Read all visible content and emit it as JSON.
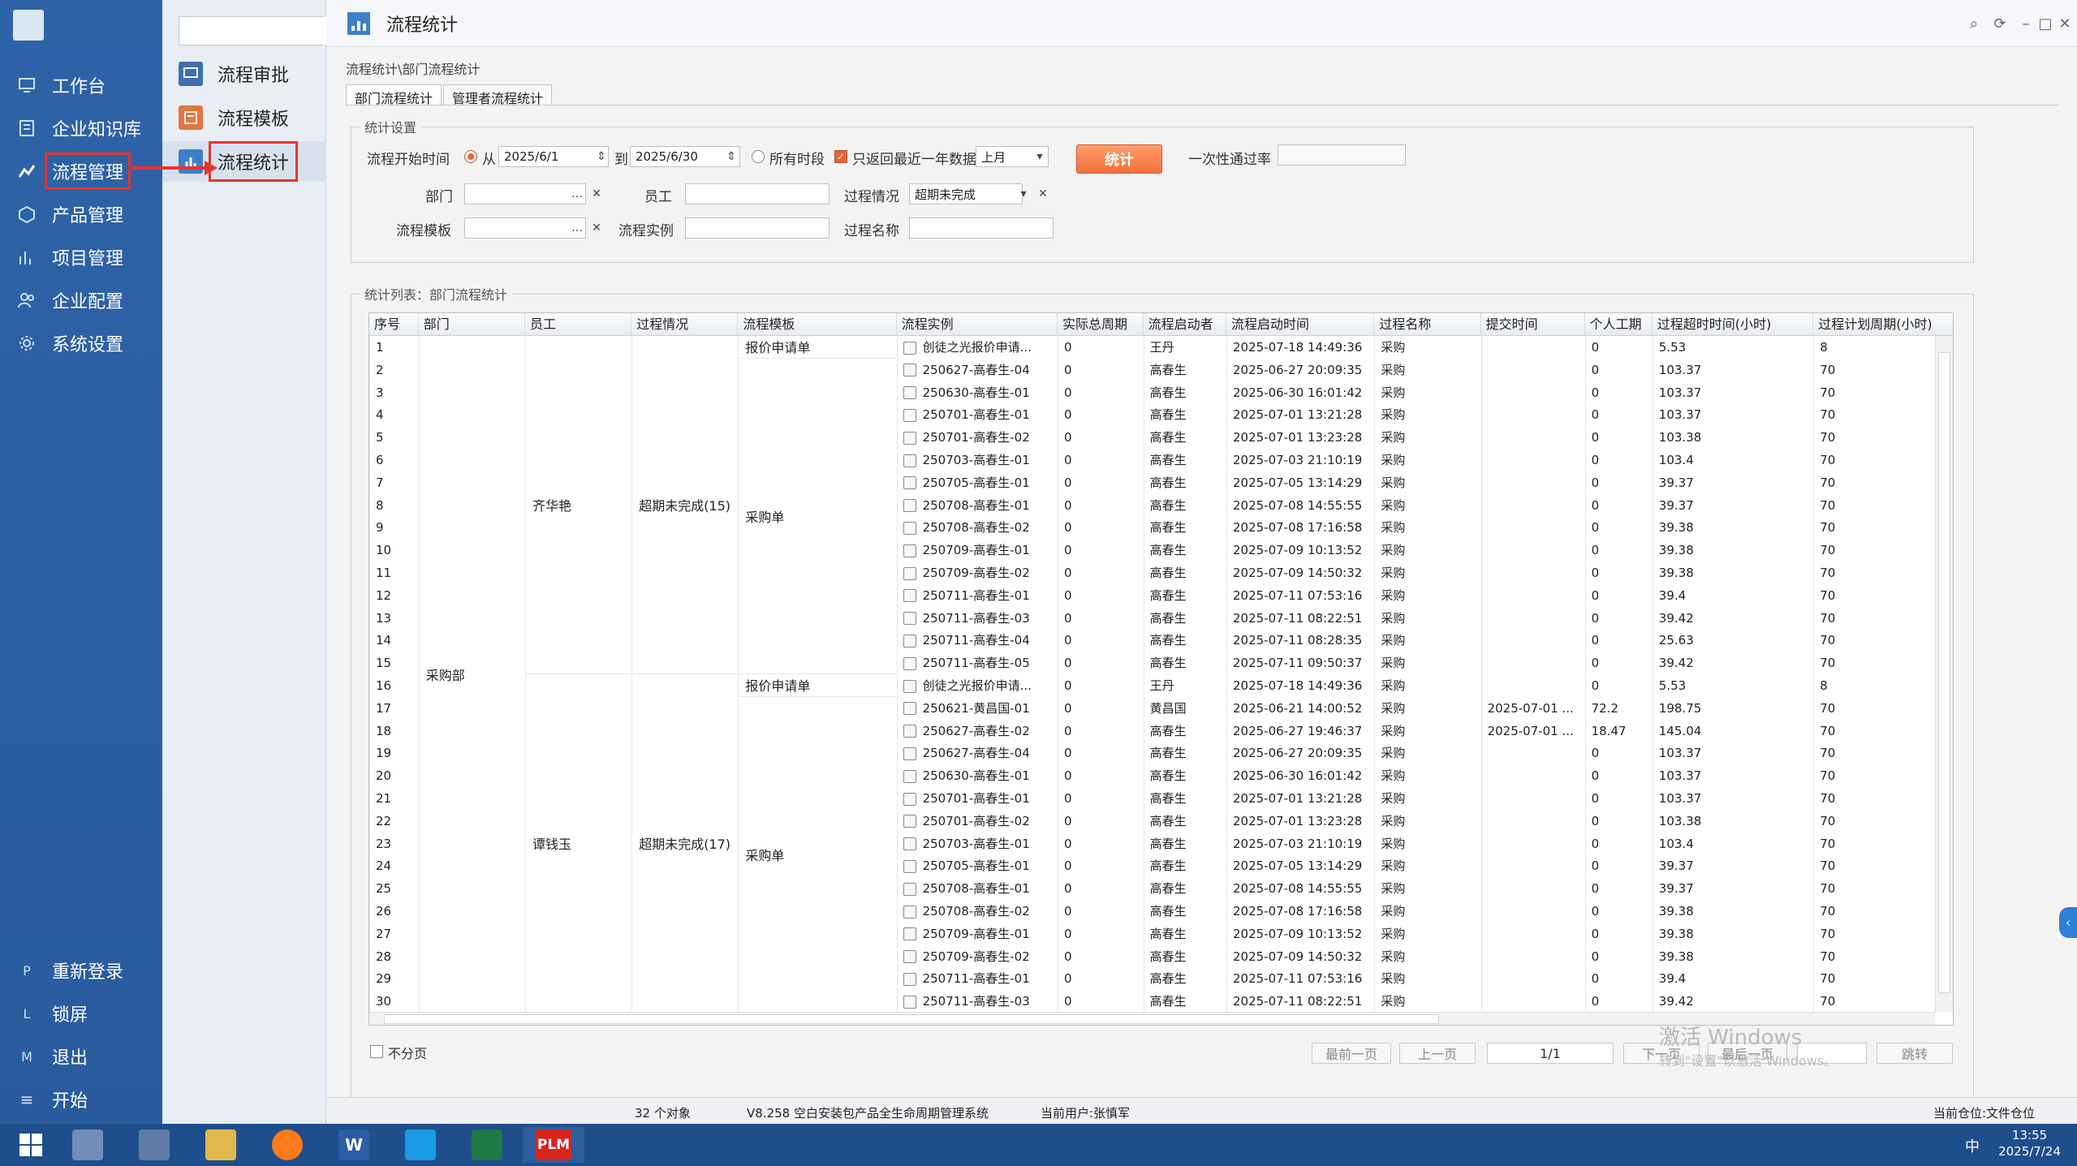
{
  "sidebar": {
    "items": [
      {
        "label": "工作台",
        "icon": "monitor-icon"
      },
      {
        "label": "企业知识库",
        "icon": "book-icon"
      },
      {
        "label": "流程管理",
        "icon": "chart-line-icon"
      },
      {
        "label": "产品管理",
        "icon": "cube-icon"
      },
      {
        "label": "项目管理",
        "icon": "bar-chart-icon"
      },
      {
        "label": "企业配置",
        "icon": "users-icon"
      },
      {
        "label": "系统设置",
        "icon": "gear-icon"
      }
    ],
    "bottom": [
      {
        "key": "P",
        "label": "重新登录"
      },
      {
        "key": "L",
        "label": "锁屏"
      },
      {
        "key": "M",
        "label": "退出"
      },
      {
        "key": "≡",
        "label": "开始"
      }
    ]
  },
  "subnav": {
    "search_value": "",
    "items": [
      {
        "label": "流程审批"
      },
      {
        "label": "流程模板"
      },
      {
        "label": "流程统计"
      }
    ]
  },
  "window": {
    "title": "流程统计"
  },
  "breadcrumb": "流程统计\\部门流程统计",
  "tabs": [
    {
      "label": "部门流程统计"
    },
    {
      "label": "管理者流程统计"
    }
  ],
  "settings": {
    "legend": "统计设置",
    "start_time_label": "流程开始时间",
    "from_label": "从",
    "from_value": "2025/6/1",
    "to_label": "到",
    "to_value": "2025/6/30",
    "all_period_label": "所有时段",
    "recent_year_label": "只返回最近一年数据",
    "period_value": "上月",
    "stat_button": "统计",
    "pass_rate_label": "一次性通过率",
    "pass_rate_value": "",
    "dept_label": "部门",
    "dept_value": "",
    "employee_label": "员工",
    "employee_value": "",
    "process_status_label": "过程情况",
    "process_status_value": "超期未完成",
    "template_label": "流程模板",
    "template_value": "",
    "instance_label": "流程实例",
    "instance_value": "",
    "process_name_label": "过程名称",
    "process_name_value": ""
  },
  "list_legend": "统计列表：部门流程统计",
  "grid": {
    "columns": [
      "序号",
      "部门",
      "员工",
      "过程情况",
      "流程模板",
      "流程实例",
      "实际总周期",
      "流程启动者",
      "流程启动时间",
      "过程名称",
      "提交时间",
      "个人工期",
      "过程超时时间(小时)",
      "过程计划周期(小时)"
    ],
    "merged": {
      "dept": "采购部",
      "emp1": "齐华艳",
      "emp1_status": "超期未完成(15)",
      "emp2": "谭钱玉",
      "emp2_status": "超期未完成(17)",
      "tmpl_quote": "报价申请单",
      "tmpl_purchase": "采购单"
    },
    "rows": [
      [
        "1",
        "创徒之光报价申请...",
        "0",
        "王丹",
        "2025-07-18 14:49:36",
        "采购",
        "",
        "0",
        "5.53",
        "8"
      ],
      [
        "2",
        "250627-高春生-04",
        "0",
        "高春生",
        "2025-06-27 20:09:35",
        "采购",
        "",
        "0",
        "103.37",
        "70"
      ],
      [
        "3",
        "250630-高春生-01",
        "0",
        "高春生",
        "2025-06-30 16:01:42",
        "采购",
        "",
        "0",
        "103.37",
        "70"
      ],
      [
        "4",
        "250701-高春生-01",
        "0",
        "高春生",
        "2025-07-01 13:21:28",
        "采购",
        "",
        "0",
        "103.37",
        "70"
      ],
      [
        "5",
        "250701-高春生-02",
        "0",
        "高春生",
        "2025-07-01 13:23:28",
        "采购",
        "",
        "0",
        "103.38",
        "70"
      ],
      [
        "6",
        "250703-高春生-01",
        "0",
        "高春生",
        "2025-07-03 21:10:19",
        "采购",
        "",
        "0",
        "103.4",
        "70"
      ],
      [
        "7",
        "250705-高春生-01",
        "0",
        "高春生",
        "2025-07-05 13:14:29",
        "采购",
        "",
        "0",
        "39.37",
        "70"
      ],
      [
        "8",
        "250708-高春生-01",
        "0",
        "高春生",
        "2025-07-08 14:55:55",
        "采购",
        "",
        "0",
        "39.37",
        "70"
      ],
      [
        "9",
        "250708-高春生-02",
        "0",
        "高春生",
        "2025-07-08 17:16:58",
        "采购",
        "",
        "0",
        "39.38",
        "70"
      ],
      [
        "10",
        "250709-高春生-01",
        "0",
        "高春生",
        "2025-07-09 10:13:52",
        "采购",
        "",
        "0",
        "39.38",
        "70"
      ],
      [
        "11",
        "250709-高春生-02",
        "0",
        "高春生",
        "2025-07-09 14:50:32",
        "采购",
        "",
        "0",
        "39.38",
        "70"
      ],
      [
        "12",
        "250711-高春生-01",
        "0",
        "高春生",
        "2025-07-11 07:53:16",
        "采购",
        "",
        "0",
        "39.4",
        "70"
      ],
      [
        "13",
        "250711-高春生-03",
        "0",
        "高春生",
        "2025-07-11 08:22:51",
        "采购",
        "",
        "0",
        "39.42",
        "70"
      ],
      [
        "14",
        "250711-高春生-04",
        "0",
        "高春生",
        "2025-07-11 08:28:35",
        "采购",
        "",
        "0",
        "25.63",
        "70"
      ],
      [
        "15",
        "250711-高春生-05",
        "0",
        "高春生",
        "2025-07-11 09:50:37",
        "采购",
        "",
        "0",
        "39.42",
        "70"
      ],
      [
        "16",
        "创徒之光报价申请...",
        "0",
        "王丹",
        "2025-07-18 14:49:36",
        "采购",
        "",
        "0",
        "5.53",
        "8"
      ],
      [
        "17",
        "250621-黄昌国-01",
        "0",
        "黄昌国",
        "2025-06-21 14:00:52",
        "采购",
        "2025-07-01 ...",
        "72.2",
        "198.75",
        "70"
      ],
      [
        "18",
        "250627-高春生-02",
        "0",
        "高春生",
        "2025-06-27 19:46:37",
        "采购",
        "2025-07-01 ...",
        "18.47",
        "145.04",
        "70"
      ],
      [
        "19",
        "250627-高春生-04",
        "0",
        "高春生",
        "2025-06-27 20:09:35",
        "采购",
        "",
        "0",
        "103.37",
        "70"
      ],
      [
        "20",
        "250630-高春生-01",
        "0",
        "高春生",
        "2025-06-30 16:01:42",
        "采购",
        "",
        "0",
        "103.37",
        "70"
      ],
      [
        "21",
        "250701-高春生-01",
        "0",
        "高春生",
        "2025-07-01 13:21:28",
        "采购",
        "",
        "0",
        "103.37",
        "70"
      ],
      [
        "22",
        "250701-高春生-02",
        "0",
        "高春生",
        "2025-07-01 13:23:28",
        "采购",
        "",
        "0",
        "103.38",
        "70"
      ],
      [
        "23",
        "250703-高春生-01",
        "0",
        "高春生",
        "2025-07-03 21:10:19",
        "采购",
        "",
        "0",
        "103.4",
        "70"
      ],
      [
        "24",
        "250705-高春生-01",
        "0",
        "高春生",
        "2025-07-05 13:14:29",
        "采购",
        "",
        "0",
        "39.37",
        "70"
      ],
      [
        "25",
        "250708-高春生-01",
        "0",
        "高春生",
        "2025-07-08 14:55:55",
        "采购",
        "",
        "0",
        "39.37",
        "70"
      ],
      [
        "26",
        "250708-高春生-02",
        "0",
        "高春生",
        "2025-07-08 17:16:58",
        "采购",
        "",
        "0",
        "39.38",
        "70"
      ],
      [
        "27",
        "250709-高春生-01",
        "0",
        "高春生",
        "2025-07-09 10:13:52",
        "采购",
        "",
        "0",
        "39.38",
        "70"
      ],
      [
        "28",
        "250709-高春生-02",
        "0",
        "高春生",
        "2025-07-09 14:50:32",
        "采购",
        "",
        "0",
        "39.38",
        "70"
      ],
      [
        "29",
        "250711-高春生-01",
        "0",
        "高春生",
        "2025-07-11 07:53:16",
        "采购",
        "",
        "0",
        "39.4",
        "70"
      ],
      [
        "30",
        "250711-高春生-03",
        "0",
        "高春生",
        "2025-07-11 08:22:51",
        "采购",
        "",
        "0",
        "39.42",
        "70"
      ]
    ]
  },
  "pager": {
    "no_paging": "不分页",
    "first": "最前一页",
    "prev": "上一页",
    "page": "1/1",
    "next": "下一页",
    "last": "最后一页",
    "jump_value": "",
    "jump": "跳转"
  },
  "statusbar": {
    "count": "32 个对象",
    "version": "V8.258 空白安装包产品全生命周期管理系统",
    "user": "当前用户:张慎军",
    "unit": "当前仓位:文件仓位"
  },
  "watermark": {
    "line1": "激活 Windows",
    "line2": "转到\"设置\"以激活 Windows。"
  },
  "taskbar": {
    "apps": [
      {
        "icon": "windows-start-icon",
        "text": ""
      },
      {
        "icon": "computer-icon",
        "text": ""
      },
      {
        "icon": "remote-icon",
        "text": ""
      },
      {
        "icon": "folder-icon",
        "text": ""
      },
      {
        "icon": "firefox-icon",
        "text": ""
      },
      {
        "icon": "word-icon",
        "text": "W"
      },
      {
        "icon": "app-icon",
        "text": ""
      },
      {
        "icon": "excel-icon",
        "text": ""
      },
      {
        "icon": "plm-icon",
        "text": "PLM"
      }
    ],
    "time": "13:55",
    "date": "2025/7/24",
    "ime": "中"
  },
  "colors": {
    "accent": "#2e63a8",
    "highlight": "#e8322f",
    "stat_button": "#f2703b"
  }
}
